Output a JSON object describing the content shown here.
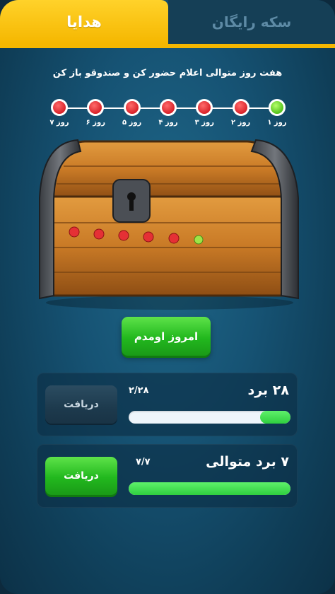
{
  "tabs": {
    "free_coins": "سکه رایگان",
    "gifts": "هدایا"
  },
  "instruction": "هفت روز متوالی اعلام حضور کن و صندوقو باز کن",
  "days": [
    {
      "label": "روز ۱",
      "done": true
    },
    {
      "label": "روز ۲",
      "done": false
    },
    {
      "label": "روز ۳",
      "done": false
    },
    {
      "label": "روز ۴",
      "done": false
    },
    {
      "label": "روز ۵",
      "done": false
    },
    {
      "label": "روز ۶",
      "done": false
    },
    {
      "label": "روز ۷",
      "done": false
    }
  ],
  "checkin_button": "امروز اومدم",
  "rewards": [
    {
      "title": "۲۸ برد",
      "progress_text": "۲/۲۸",
      "progress": 0.19,
      "claim_label": "دریافت",
      "claimable": false
    },
    {
      "title": "۷ برد متوالی",
      "progress_text": "۷/۷",
      "progress": 1.0,
      "claim_label": "دریافت",
      "claimable": true
    }
  ],
  "colors": {
    "tab_active": "#f5b700",
    "tab_inactive": "#153f56",
    "button_green": "#22b81e",
    "dot_red": "#d9232a",
    "dot_green": "#55c21c"
  }
}
